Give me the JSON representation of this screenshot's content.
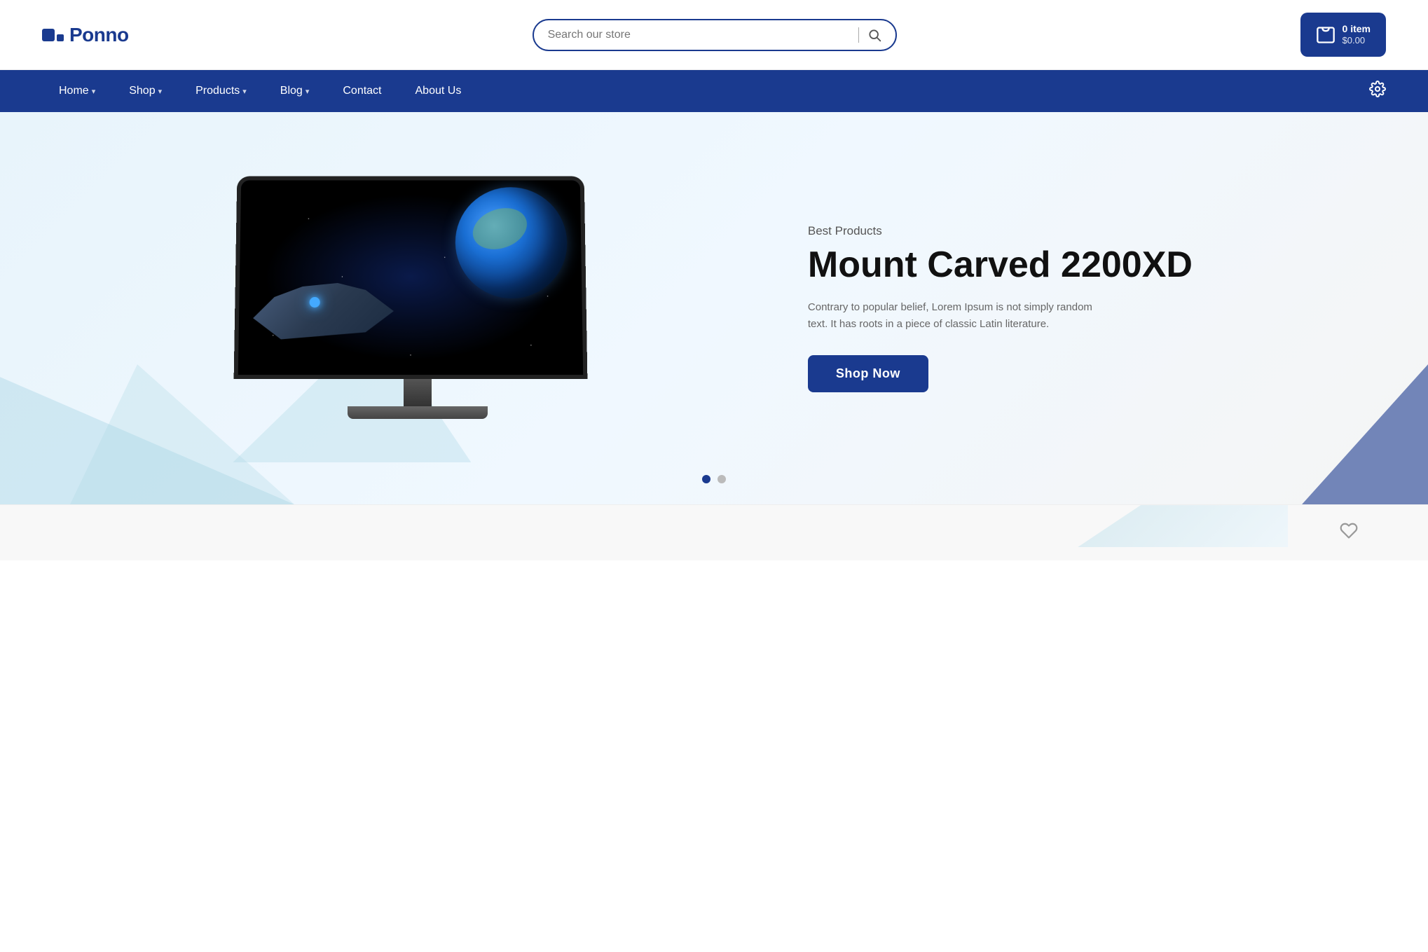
{
  "header": {
    "logo_text": "Ponno",
    "search_placeholder": "Search our store",
    "cart_items": "0 item",
    "cart_price": "$0.00"
  },
  "navbar": {
    "items": [
      {
        "label": "Home",
        "has_dropdown": true
      },
      {
        "label": "Shop",
        "has_dropdown": true
      },
      {
        "label": "Products",
        "has_dropdown": true
      },
      {
        "label": "Blog",
        "has_dropdown": true
      },
      {
        "label": "Contact",
        "has_dropdown": false
      },
      {
        "label": "About Us",
        "has_dropdown": false
      }
    ]
  },
  "hero": {
    "subtitle": "Best Products",
    "title": "Mount Carved 2200XD",
    "description": "Contrary to popular belief, Lorem Ipsum is not simply random text. It has roots in a piece of classic Latin literature.",
    "cta_label": "Shop Now"
  },
  "carousel": {
    "total_dots": 2,
    "active_dot": 0
  }
}
